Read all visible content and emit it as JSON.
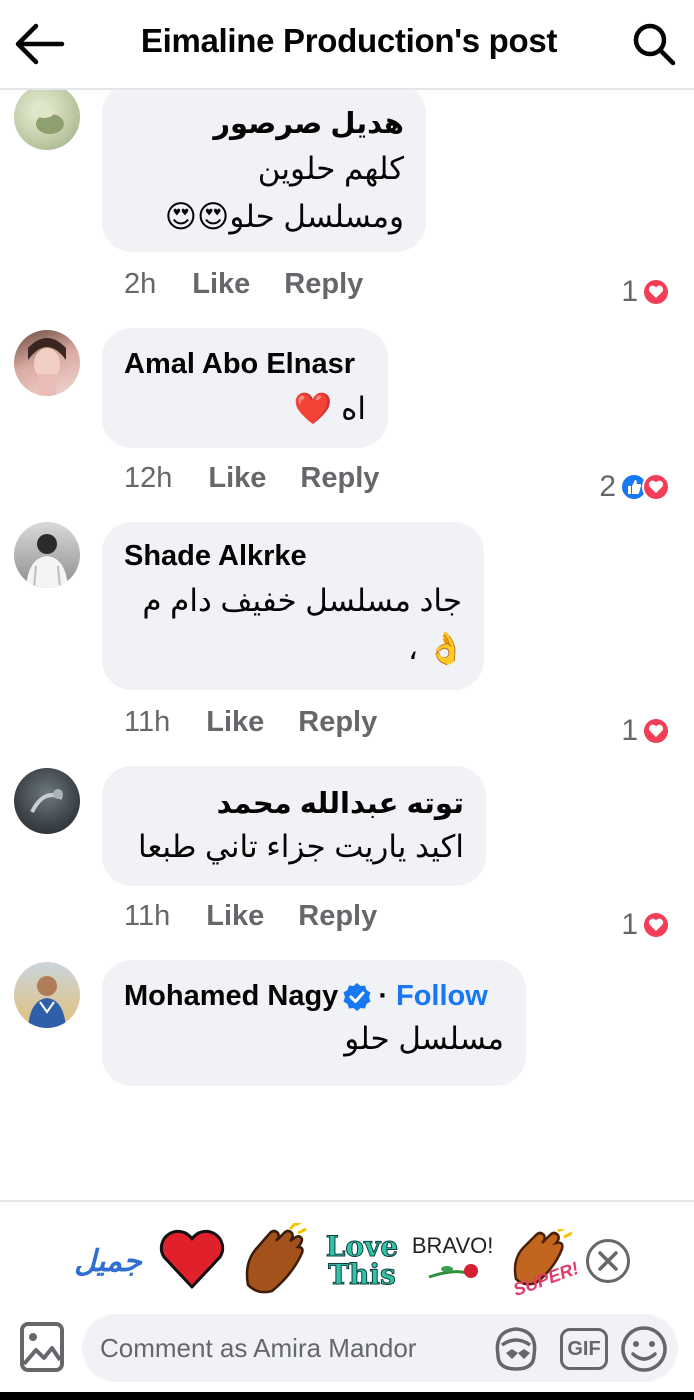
{
  "header": {
    "title": "Eimaline Production's post"
  },
  "comments": [
    {
      "author": "هديل صرصور",
      "lines": [
        "كلهم حلوين",
        "ومسلسل حلو😍😍"
      ],
      "time": "2h",
      "like_label": "Like",
      "reply_label": "Reply",
      "reaction_count": "1",
      "reactions": [
        "love"
      ]
    },
    {
      "author": "Amal Abo Elnasr",
      "lines": [
        "اه ❤️"
      ],
      "time": "12h",
      "like_label": "Like",
      "reply_label": "Reply",
      "reaction_count": "2",
      "reactions": [
        "like",
        "love"
      ]
    },
    {
      "author": "Shade Alkrke",
      "lines": [
        "جاد مسلسل خفيف دام م",
        "، 👌"
      ],
      "time": "11h",
      "like_label": "Like",
      "reply_label": "Reply",
      "reaction_count": "1",
      "reactions": [
        "love"
      ]
    },
    {
      "author": "توته عبدالله محمد",
      "lines": [
        "اكيد ياريت جزاء تاني طبعا"
      ],
      "time": "11h",
      "like_label": "Like",
      "reply_label": "Reply",
      "reaction_count": "1",
      "reactions": [
        "love"
      ]
    },
    {
      "author": "Mohamed Nagy",
      "verified": true,
      "follow_separator": "·",
      "follow_label": "Follow",
      "lines": [
        "مسلسل حلو"
      ]
    }
  ],
  "stickers": [
    "جميل",
    "heart",
    "clap",
    "Love This",
    "BRAVO!",
    "SUPER!"
  ],
  "composer": {
    "placeholder": "Comment as Amira Mandor",
    "gif_label": "GIF"
  },
  "colors": {
    "accent": "#1877f2",
    "love": "#f33e58",
    "bubble": "#f0f2f5",
    "meta_text": "#65676b"
  },
  "icons": [
    "back-arrow-icon",
    "search-icon",
    "love-reaction-icon",
    "like-reaction-icon",
    "verified-badge-icon",
    "close-icon",
    "photo-icon",
    "avatar-sticker-icon",
    "gif-icon",
    "emoji-icon"
  ]
}
